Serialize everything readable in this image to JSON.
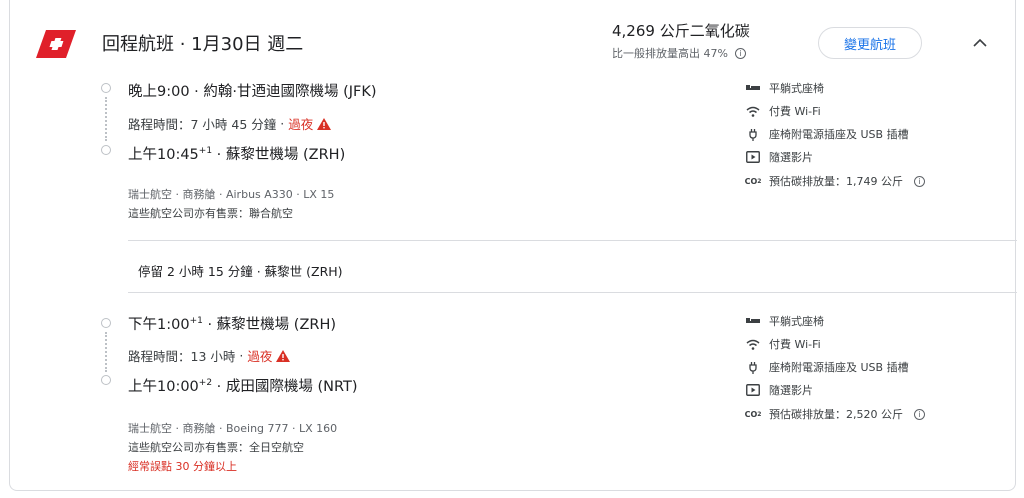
{
  "header": {
    "title": "回程航班 · 1月30日 週二",
    "emissions": "4,269 公斤二氧化碳",
    "emissions_note": "比一般排放量高出 47%",
    "change_button": "變更航班"
  },
  "colors": {
    "brand_red": "#e0202a",
    "accent_blue": "#1a73e8",
    "warning_red": "#d93025"
  },
  "legs": [
    {
      "depart_time": "晚上9:00",
      "depart_sup": "",
      "depart_airport": "約翰·甘迺迪國際機場 (JFK)",
      "duration": "路程時間：7 小時 45 分鐘",
      "overnight": "過夜",
      "arrive_time": "上午10:45",
      "arrive_sup": "+1",
      "arrive_airport": "蘇黎世機場 (ZRH)",
      "details": "瑞士航空 · 商務艙 · Airbus A330 · LX 15",
      "also_sold": "這些航空公司亦有售票：聯合航空",
      "delay": "",
      "amenities": [
        "平躺式座椅",
        "付費 Wi-Fi",
        "座椅附電源插座及 USB 插槽",
        "隨選影片",
        "預估碳排放量：1,749 公斤"
      ]
    },
    {
      "depart_time": "下午1:00",
      "depart_sup": "+1",
      "depart_airport": "蘇黎世機場 (ZRH)",
      "duration": "路程時間：13 小時",
      "overnight": "過夜",
      "arrive_time": "上午10:00",
      "arrive_sup": "+2",
      "arrive_airport": "成田國際機場 (NRT)",
      "details": "瑞士航空 · 商務艙 · Boeing 777 · LX 160",
      "also_sold": "這些航空公司亦有售票：全日空航空",
      "delay": "經常誤點 30 分鐘以上",
      "amenities": [
        "平躺式座椅",
        "付費 Wi-Fi",
        "座椅附電源插座及 USB 插槽",
        "隨選影片",
        "預估碳排放量：2,520 公斤"
      ]
    }
  ],
  "layover": "停留 2 小時 15 分鐘 · 蘇黎世 (ZRH)",
  "icons": [
    "swiss-logo",
    "info-icon",
    "chevron-up-icon",
    "seat-icon",
    "wifi-icon",
    "power-plug-icon",
    "video-icon",
    "co2-icon",
    "warning-icon"
  ]
}
